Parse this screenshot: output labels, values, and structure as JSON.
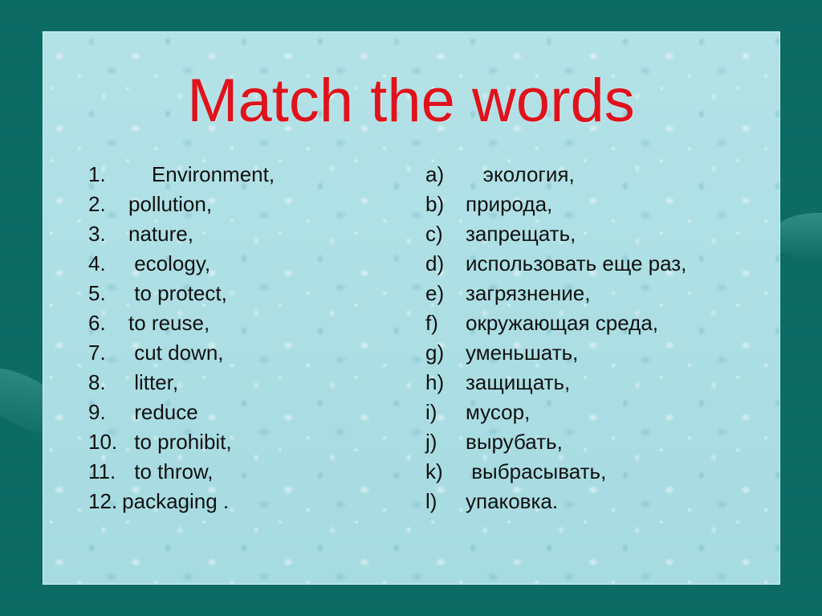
{
  "slide": {
    "title": "Match the words",
    "colors": {
      "background": "#0a6a63",
      "panel": "#a9dde3",
      "title": "#e0121b",
      "text": "#111111"
    },
    "english_terms": [
      {
        "marker": "1.",
        "text": "    Environment,"
      },
      {
        "marker": "2.",
        "text": "pollution,"
      },
      {
        "marker": "3.",
        "text": "nature,"
      },
      {
        "marker": "4.",
        "text": " ecology,"
      },
      {
        "marker": "5.",
        "text": " to protect,"
      },
      {
        "marker": "6.",
        "text": "to reuse,"
      },
      {
        "marker": "7.",
        "text": " cut down,"
      },
      {
        "marker": "8.",
        "text": " litter,"
      },
      {
        "marker": "9.",
        "text": " reduce"
      },
      {
        "marker": "10.",
        "text": " to prohibit,"
      },
      {
        "marker": "11.",
        "text": " to throw,"
      },
      {
        "marker": "12.",
        "text": "packaging ."
      }
    ],
    "russian_terms": [
      {
        "marker": "a)",
        "text": "   экология,"
      },
      {
        "marker": "b)",
        "text": "природа,"
      },
      {
        "marker": "c)",
        "text": "запрещать,"
      },
      {
        "marker": "d)",
        "text": "использовать еще раз,"
      },
      {
        "marker": "e)",
        "text": "загрязнение,"
      },
      {
        "marker": "f)",
        "text": "окружающая среда,"
      },
      {
        "marker": "g)",
        "text": "уменьшать,"
      },
      {
        "marker": "h)",
        "text": "защищать,"
      },
      {
        "marker": "i)",
        "text": "мусор,"
      },
      {
        "marker": "j)",
        "text": "вырубать,"
      },
      {
        "marker": "k)",
        "text": " выбрасывать,"
      },
      {
        "marker": "l)",
        "text": "упаковка."
      }
    ]
  }
}
